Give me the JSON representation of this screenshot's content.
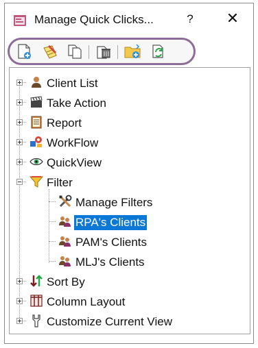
{
  "window": {
    "title": "Manage Quick Clicks...",
    "help_label": "?",
    "close_label": "✕"
  },
  "toolbar": {
    "buttons": [
      {
        "name": "new-icon"
      },
      {
        "name": "edit-icon"
      },
      {
        "name": "copy-icon"
      },
      {
        "name": "delete-icon"
      },
      {
        "name": "folder-add-icon"
      },
      {
        "name": "refresh-icon"
      }
    ]
  },
  "tree": {
    "items": [
      {
        "label": "Client List",
        "icon": "client-icon",
        "expander": "plus"
      },
      {
        "label": "Take Action",
        "icon": "clapper-icon",
        "expander": "plus"
      },
      {
        "label": "Report",
        "icon": "report-icon",
        "expander": "plus"
      },
      {
        "label": "WorkFlow",
        "icon": "workflow-icon",
        "expander": "plus"
      },
      {
        "label": "QuickView",
        "icon": "eye-icon",
        "expander": "plus"
      },
      {
        "label": "Filter",
        "icon": "filter-icon",
        "expander": "minus"
      },
      {
        "label": "Sort By",
        "icon": "sort-icon",
        "expander": "plus"
      },
      {
        "label": "Column Layout",
        "icon": "columns-icon",
        "expander": "plus"
      },
      {
        "label": "Customize Current View",
        "icon": "wrench-icon",
        "expander": "plus"
      }
    ],
    "filter_children": [
      {
        "label": "Manage Filters",
        "icon": "tools-icon",
        "selected": false
      },
      {
        "label": "RPA's Clients",
        "icon": "clients-filter-icon",
        "selected": true
      },
      {
        "label": "PAM's Clients",
        "icon": "clients-filter-icon",
        "selected": false
      },
      {
        "label": "MLJ's Clients",
        "icon": "clients-filter-icon",
        "selected": false
      }
    ]
  },
  "colors": {
    "selection": "#0b78d7",
    "toolbar_outline": "#8e6c98"
  }
}
